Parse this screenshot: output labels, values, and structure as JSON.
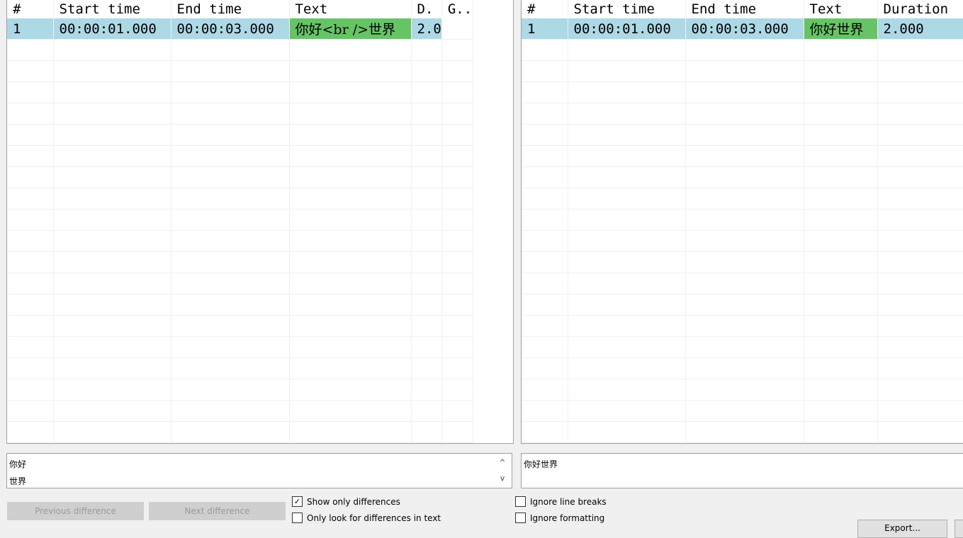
{
  "left_grid": {
    "headers": [
      "#",
      "Start time",
      "End time",
      "Text",
      "D.",
      "G.."
    ],
    "rows": [
      {
        "num": "1",
        "start": "00:00:01.000",
        "end": "00:00:03.000",
        "text": "你好<br />世界",
        "duration": "2.0",
        "gap": ""
      }
    ]
  },
  "right_grid": {
    "headers": [
      "#",
      "Start time",
      "End time",
      "Text",
      "Duration"
    ],
    "rows": [
      {
        "num": "1",
        "start": "00:00:01.000",
        "end": "00:00:03.000",
        "text": "你好世界",
        "duration": "2.000"
      }
    ]
  },
  "left_text": {
    "line1": "你好",
    "line2": "世界",
    "scroll_up": "^",
    "scroll_down": "v"
  },
  "right_text": {
    "line1": "你好世界"
  },
  "buttons": {
    "previous": "Previous difference",
    "next": "Next difference",
    "export": "Export..."
  },
  "options": {
    "show_only_differences": {
      "label": "Show only differences",
      "checked": true,
      "mark": "✓"
    },
    "only_text": {
      "label": "Only look for differences in text",
      "checked": false
    },
    "ignore_line_breaks": {
      "label": "Ignore line breaks",
      "checked": false
    },
    "ignore_formatting": {
      "label": "Ignore formatting",
      "checked": false
    }
  },
  "colors": {
    "selected_row": "#add8e6",
    "difference": "#66c466"
  }
}
